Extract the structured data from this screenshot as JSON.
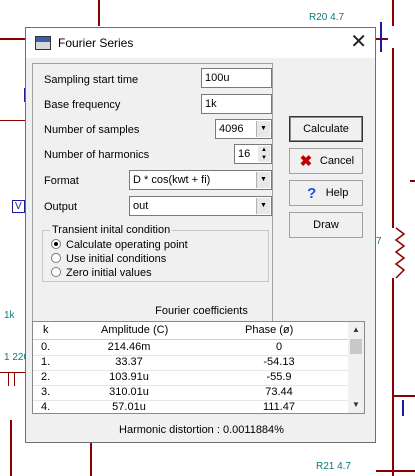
{
  "background": {
    "labels": {
      "r20": "R20 4.7",
      "r21": "R21 4.7",
      "k1": "1k",
      "c220": "1 220",
      "v": "V",
      "seven": "7"
    }
  },
  "dialog": {
    "title": "Fourier Series",
    "close_glyph": "✕",
    "fields": {
      "sampling_start_time": {
        "label": "Sampling start time",
        "value": "100u"
      },
      "base_frequency": {
        "label": "Base frequency",
        "value": "1k"
      },
      "number_of_samples": {
        "label": "Number of samples",
        "value": "4096"
      },
      "number_of_harmonics": {
        "label": "Number of harmonics",
        "value": "16"
      },
      "format": {
        "label": "Format",
        "value": "D * cos(kwt + fi)"
      },
      "output": {
        "label": "Output",
        "value": "out"
      }
    },
    "transient": {
      "title": "Transient inital condition",
      "options": [
        {
          "label": "Calculate operating point",
          "selected": true
        },
        {
          "label": "Use initial conditions",
          "selected": false
        },
        {
          "label": "Zero initial values",
          "selected": false
        }
      ]
    },
    "buttons": {
      "calculate": "Calculate",
      "cancel": "Cancel",
      "help": "Help",
      "draw": "Draw"
    },
    "coefficients": {
      "title": "Fourier coefficients",
      "columns": [
        "k",
        "Amplitude (C)",
        "Phase (ø)"
      ],
      "rows": [
        {
          "k": "0.",
          "amp": "214.46m",
          "phase": "0"
        },
        {
          "k": "1.",
          "amp": "33.37",
          "phase": "-54.13"
        },
        {
          "k": "2.",
          "amp": "103.91u",
          "phase": "-55.9"
        },
        {
          "k": "3.",
          "amp": "310.01u",
          "phase": "73.44"
        },
        {
          "k": "4.",
          "amp": "57.01u",
          "phase": "111.47"
        }
      ]
    },
    "harmonic_distortion": {
      "label": "Harmonic distortion :",
      "value": "0.0011884%"
    }
  },
  "icons": {
    "cancel": "cross-icon",
    "help": "question-icon",
    "title": "fourier-app-icon"
  },
  "colors": {
    "schematic_wire": "#8b0000",
    "schematic_label": "#0a7a7a",
    "dialog_bg": "#f0f0f0",
    "cancel_icon": "#c00000",
    "help_icon": "#1f4fd8"
  }
}
